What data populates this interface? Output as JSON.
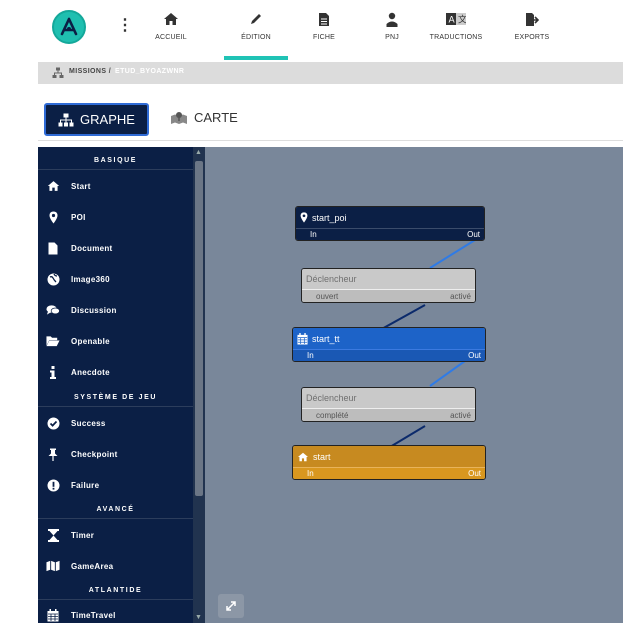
{
  "nav": {
    "items": [
      {
        "label": "ACCUEIL",
        "icon": "home-icon"
      },
      {
        "label": "ÉDITION",
        "icon": "pencil-icon"
      },
      {
        "label": "FICHE",
        "icon": "document-icon"
      },
      {
        "label": "PNJ",
        "icon": "person-icon"
      },
      {
        "label": "TRADUCTIONS",
        "icon": "translate-icon"
      },
      {
        "label": "EXPORTS",
        "icon": "export-icon"
      }
    ],
    "active": "ÉDITION",
    "accent": "#20c3b5"
  },
  "breadcrumb": {
    "root": "MISSIONS /",
    "current": "ETUD_BYOAZWNR"
  },
  "tabs": {
    "graphe": "GRAPHE",
    "carte": "CARTE"
  },
  "sidebar": {
    "sections": [
      {
        "title": "BASIQUE",
        "items": [
          {
            "label": "Start",
            "icon": "home-icon"
          },
          {
            "label": "POI",
            "icon": "map-marker-icon"
          },
          {
            "label": "Document",
            "icon": "file-icon"
          },
          {
            "label": "Image360",
            "icon": "globe-icon"
          },
          {
            "label": "Discussion",
            "icon": "comments-icon"
          },
          {
            "label": "Openable",
            "icon": "folder-open-icon"
          },
          {
            "label": "Anecdote",
            "icon": "info-icon"
          }
        ]
      },
      {
        "title": "SYSTÈME DE JEU",
        "items": [
          {
            "label": "Success",
            "icon": "check-circle-icon"
          },
          {
            "label": "Checkpoint",
            "icon": "pin-icon"
          },
          {
            "label": "Failure",
            "icon": "exclamation-circle-icon"
          }
        ]
      },
      {
        "title": "AVANCÉ",
        "items": [
          {
            "label": "Timer",
            "icon": "hourglass-icon"
          },
          {
            "label": "GameArea",
            "icon": "map-icon"
          }
        ]
      },
      {
        "title": "ATLANTIDE",
        "items": [
          {
            "label": "TimeTravel",
            "icon": "calendar-icon"
          }
        ]
      }
    ]
  },
  "graph": {
    "nodes": [
      {
        "id": "start_poi",
        "title": "start_poi",
        "in": "In",
        "out": "Out",
        "style": "dark",
        "icon": "map-marker-icon"
      },
      {
        "id": "trigger1",
        "title": "Déclencheur",
        "in": "ouvert",
        "out": "activé",
        "style": "gray"
      },
      {
        "id": "start_tt",
        "title": "start_tt",
        "in": "In",
        "out": "Out",
        "style": "blue",
        "icon": "calendar-icon"
      },
      {
        "id": "trigger2",
        "title": "Déclencheur",
        "in": "complété",
        "out": "activé",
        "style": "gray"
      },
      {
        "id": "start",
        "title": "start",
        "in": "In",
        "out": "Out",
        "style": "orange",
        "icon": "home-icon"
      }
    ],
    "colors": {
      "dark": "#0b1f45",
      "blue": "#1d63c8",
      "orange": "#c78a20",
      "gray": "#c9c9c9",
      "canvas": "#79879a",
      "wire_blue": "#2f7be6",
      "wire_dark": "#0b2a6b"
    }
  }
}
